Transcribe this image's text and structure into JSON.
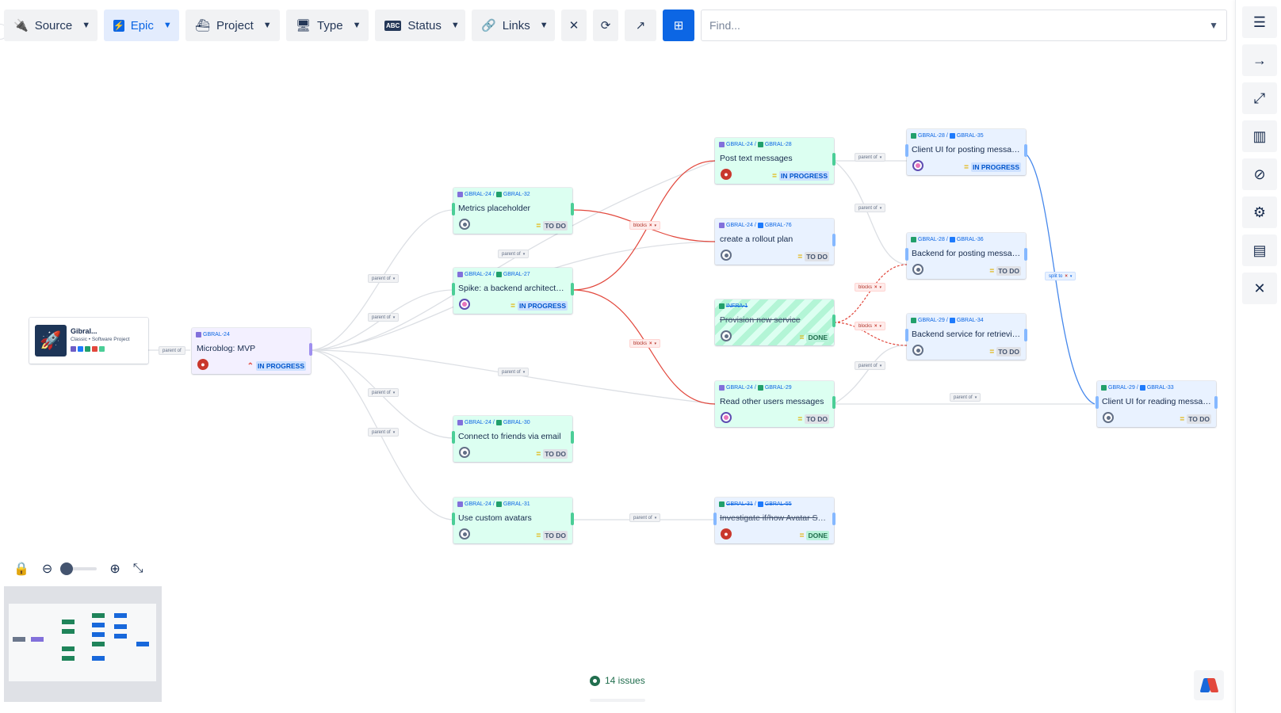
{
  "toolbar": {
    "source": "Source",
    "epic": "Epic",
    "project": "Project",
    "type": "Type",
    "status": "Status",
    "links": "Links",
    "find_placeholder": "Find..."
  },
  "project_card": {
    "name": "Gibral...",
    "type": "Classic • Software Project"
  },
  "links": {
    "parent_of": "parent of",
    "blocks": "blocks",
    "split_to": "split to"
  },
  "cards": {
    "mvp": {
      "epic": "GBRAL-24",
      "key": "",
      "title": "Microblog: MVP",
      "status": "IN PROGRESS"
    },
    "c32": {
      "epic": "GBRAL-24",
      "key": "GBRAL-32",
      "title": "Metrics placeholder",
      "status": "TO DO"
    },
    "c27": {
      "epic": "GBRAL-24",
      "key": "GBRAL-27",
      "title": "Spike: a backend architecture f...",
      "status": "IN PROGRESS"
    },
    "c30": {
      "epic": "GBRAL-24",
      "key": "GBRAL-30",
      "title": "Connect to friends via email",
      "status": "TO DO"
    },
    "c31": {
      "epic": "GBRAL-24",
      "key": "GBRAL-31",
      "title": "Use custom avatars",
      "status": "TO DO"
    },
    "c28": {
      "epic": "GBRAL-24",
      "key": "GBRAL-28",
      "title": "Post text messages",
      "status": "IN PROGRESS"
    },
    "c76": {
      "epic": "GBRAL-24",
      "key": "GBRAL-76",
      "title": "create a rollout plan",
      "status": "TO DO"
    },
    "infra": {
      "epic": "INFRA-1",
      "key": "",
      "title": "Provision new service",
      "status": "DONE"
    },
    "c29": {
      "epic": "GBRAL-24",
      "key": "GBRAL-29",
      "title": "Read other users messages",
      "status": "TO DO"
    },
    "c55": {
      "epic": "GBRAL-31",
      "key": "GBRAL-55",
      "title": "Investigate if/how Avatar Servi...",
      "status": "DONE"
    },
    "c35": {
      "epic": "GBRAL-28",
      "key": "GBRAL-35",
      "title": "Client UI for posting messages",
      "status": "IN PROGRESS"
    },
    "c36": {
      "epic": "GBRAL-28",
      "key": "GBRAL-36",
      "title": "Backend for posting messages",
      "status": "TO DO"
    },
    "c34": {
      "epic": "GBRAL-29",
      "key": "GBRAL-34",
      "title": "Backend service for retrieving...",
      "status": "TO DO"
    },
    "c33": {
      "epic": "GBRAL-29",
      "key": "GBRAL-33",
      "title": "Client UI for reading messages",
      "status": "TO DO"
    }
  },
  "footer": {
    "issue_count": "14 issues"
  },
  "colors": {
    "accent": "#0c66e4",
    "blocks_link": "#e2483d",
    "split_link": "#4688ec",
    "parent_link": "#c1c7d0"
  },
  "icons": [
    "plug-icon",
    "bolt-icon",
    "boat-icon",
    "monitor-icon",
    "abc-icon",
    "link-icon",
    "close-icon",
    "sync-icon",
    "arrow-up-right-icon",
    "add-screen-icon",
    "chevron-down-icon",
    "menu-icon",
    "arrow-right-icon",
    "expand-icon",
    "columns-icon",
    "block-icon",
    "layers-icon",
    "layout-icon",
    "lock-icon",
    "zoom-out-icon",
    "zoom-in-icon",
    "collapse-icon",
    "eye-icon"
  ]
}
